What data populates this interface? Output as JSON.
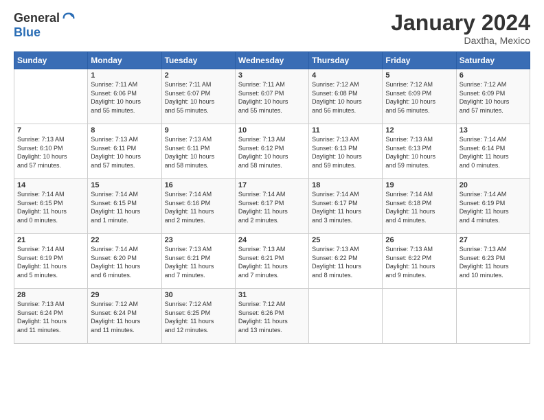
{
  "logo": {
    "line1": "General",
    "line2": "Blue"
  },
  "title": "January 2024",
  "location": "Daxtha, Mexico",
  "weekdays": [
    "Sunday",
    "Monday",
    "Tuesday",
    "Wednesday",
    "Thursday",
    "Friday",
    "Saturday"
  ],
  "weeks": [
    [
      {
        "day": "",
        "info": ""
      },
      {
        "day": "1",
        "info": "Sunrise: 7:11 AM\nSunset: 6:06 PM\nDaylight: 10 hours\nand 55 minutes."
      },
      {
        "day": "2",
        "info": "Sunrise: 7:11 AM\nSunset: 6:07 PM\nDaylight: 10 hours\nand 55 minutes."
      },
      {
        "day": "3",
        "info": "Sunrise: 7:11 AM\nSunset: 6:07 PM\nDaylight: 10 hours\nand 55 minutes."
      },
      {
        "day": "4",
        "info": "Sunrise: 7:12 AM\nSunset: 6:08 PM\nDaylight: 10 hours\nand 56 minutes."
      },
      {
        "day": "5",
        "info": "Sunrise: 7:12 AM\nSunset: 6:09 PM\nDaylight: 10 hours\nand 56 minutes."
      },
      {
        "day": "6",
        "info": "Sunrise: 7:12 AM\nSunset: 6:09 PM\nDaylight: 10 hours\nand 57 minutes."
      }
    ],
    [
      {
        "day": "7",
        "info": "Sunrise: 7:13 AM\nSunset: 6:10 PM\nDaylight: 10 hours\nand 57 minutes."
      },
      {
        "day": "8",
        "info": "Sunrise: 7:13 AM\nSunset: 6:11 PM\nDaylight: 10 hours\nand 57 minutes."
      },
      {
        "day": "9",
        "info": "Sunrise: 7:13 AM\nSunset: 6:11 PM\nDaylight: 10 hours\nand 58 minutes."
      },
      {
        "day": "10",
        "info": "Sunrise: 7:13 AM\nSunset: 6:12 PM\nDaylight: 10 hours\nand 58 minutes."
      },
      {
        "day": "11",
        "info": "Sunrise: 7:13 AM\nSunset: 6:13 PM\nDaylight: 10 hours\nand 59 minutes."
      },
      {
        "day": "12",
        "info": "Sunrise: 7:13 AM\nSunset: 6:13 PM\nDaylight: 10 hours\nand 59 minutes."
      },
      {
        "day": "13",
        "info": "Sunrise: 7:14 AM\nSunset: 6:14 PM\nDaylight: 11 hours\nand 0 minutes."
      }
    ],
    [
      {
        "day": "14",
        "info": "Sunrise: 7:14 AM\nSunset: 6:15 PM\nDaylight: 11 hours\nand 0 minutes."
      },
      {
        "day": "15",
        "info": "Sunrise: 7:14 AM\nSunset: 6:15 PM\nDaylight: 11 hours\nand 1 minute."
      },
      {
        "day": "16",
        "info": "Sunrise: 7:14 AM\nSunset: 6:16 PM\nDaylight: 11 hours\nand 2 minutes."
      },
      {
        "day": "17",
        "info": "Sunrise: 7:14 AM\nSunset: 6:17 PM\nDaylight: 11 hours\nand 2 minutes."
      },
      {
        "day": "18",
        "info": "Sunrise: 7:14 AM\nSunset: 6:17 PM\nDaylight: 11 hours\nand 3 minutes."
      },
      {
        "day": "19",
        "info": "Sunrise: 7:14 AM\nSunset: 6:18 PM\nDaylight: 11 hours\nand 4 minutes."
      },
      {
        "day": "20",
        "info": "Sunrise: 7:14 AM\nSunset: 6:19 PM\nDaylight: 11 hours\nand 4 minutes."
      }
    ],
    [
      {
        "day": "21",
        "info": "Sunrise: 7:14 AM\nSunset: 6:19 PM\nDaylight: 11 hours\nand 5 minutes."
      },
      {
        "day": "22",
        "info": "Sunrise: 7:14 AM\nSunset: 6:20 PM\nDaylight: 11 hours\nand 6 minutes."
      },
      {
        "day": "23",
        "info": "Sunrise: 7:13 AM\nSunset: 6:21 PM\nDaylight: 11 hours\nand 7 minutes."
      },
      {
        "day": "24",
        "info": "Sunrise: 7:13 AM\nSunset: 6:21 PM\nDaylight: 11 hours\nand 7 minutes."
      },
      {
        "day": "25",
        "info": "Sunrise: 7:13 AM\nSunset: 6:22 PM\nDaylight: 11 hours\nand 8 minutes."
      },
      {
        "day": "26",
        "info": "Sunrise: 7:13 AM\nSunset: 6:22 PM\nDaylight: 11 hours\nand 9 minutes."
      },
      {
        "day": "27",
        "info": "Sunrise: 7:13 AM\nSunset: 6:23 PM\nDaylight: 11 hours\nand 10 minutes."
      }
    ],
    [
      {
        "day": "28",
        "info": "Sunrise: 7:13 AM\nSunset: 6:24 PM\nDaylight: 11 hours\nand 11 minutes."
      },
      {
        "day": "29",
        "info": "Sunrise: 7:12 AM\nSunset: 6:24 PM\nDaylight: 11 hours\nand 11 minutes."
      },
      {
        "day": "30",
        "info": "Sunrise: 7:12 AM\nSunset: 6:25 PM\nDaylight: 11 hours\nand 12 minutes."
      },
      {
        "day": "31",
        "info": "Sunrise: 7:12 AM\nSunset: 6:26 PM\nDaylight: 11 hours\nand 13 minutes."
      },
      {
        "day": "",
        "info": ""
      },
      {
        "day": "",
        "info": ""
      },
      {
        "day": "",
        "info": ""
      }
    ]
  ]
}
